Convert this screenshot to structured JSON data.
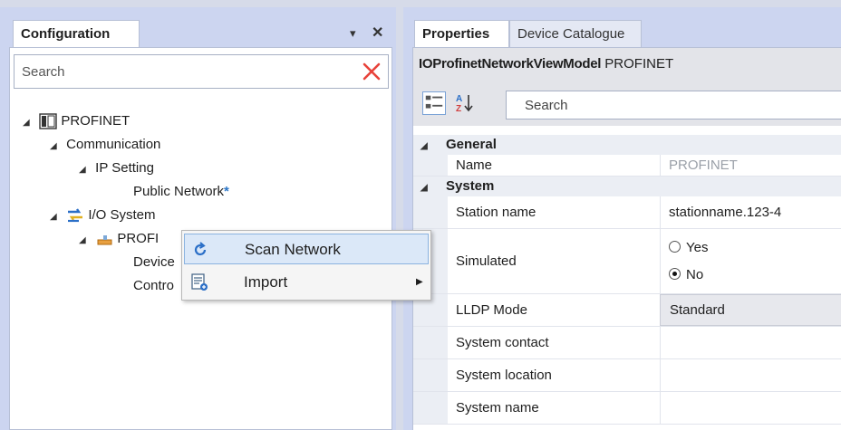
{
  "configuration_panel": {
    "tab_label": "Configuration",
    "pin_glyph": "▾",
    "close_glyph": "✕",
    "search_placeholder": "Search",
    "tree": {
      "root": "PROFINET",
      "communication": "Communication",
      "ip_setting": "IP Setting",
      "public_network": "Public Network",
      "public_network_marker": "*",
      "io_system": "I/O System",
      "io_child": "PROFI",
      "device_child": "Device",
      "control_child": "Contro"
    }
  },
  "context_menu": {
    "items": [
      {
        "label": "Scan Network",
        "icon": "refresh-icon",
        "highlighted": true
      },
      {
        "label": "Import",
        "icon": "import-icon",
        "has_submenu": true
      }
    ]
  },
  "properties_panel": {
    "tabs": [
      {
        "label": "Properties",
        "active": true
      },
      {
        "label": "Device Catalogue",
        "active": false
      }
    ],
    "header_type": "IOProfinetNetworkViewModel",
    "header_name": "PROFINET",
    "search_placeholder": "Search",
    "categories": {
      "general": "General",
      "system": "System"
    },
    "properties": {
      "name_label": "Name",
      "name_value": "PROFINET",
      "station_label": "Station name",
      "station_value": "stationname.123-4",
      "simulated_label": "Simulated",
      "simulated_yes": "Yes",
      "simulated_no": "No",
      "simulated_selected": "No",
      "lldp_label": "LLDP Mode",
      "lldp_value": "Standard",
      "contact_label": "System contact",
      "location_label": "System location",
      "sysname_label": "System name"
    }
  },
  "colors": {
    "panel_background": "#ccd5f0",
    "accent_blue": "#2b76c7",
    "clear_red": "#e8423a",
    "highlight": "#dbe8f8"
  }
}
